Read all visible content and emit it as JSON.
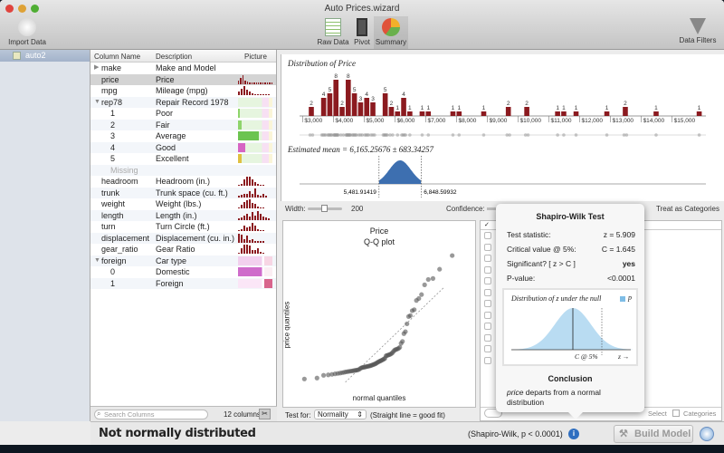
{
  "window": {
    "title": "Auto Prices.wizard"
  },
  "toolbar": {
    "import": "Import Data",
    "raw": "Raw Data",
    "pivot": "Pivot",
    "summary": "Summary",
    "filters": "Data Filters"
  },
  "sidebar": {
    "items": [
      {
        "label": "auto2"
      }
    ]
  },
  "columns": {
    "headers": [
      "Column Name",
      "Description",
      "Picture"
    ],
    "rows": [
      {
        "name": "make",
        "desc": "Make and Model",
        "tri": "▶",
        "spark": []
      },
      {
        "name": "price",
        "desc": "Price",
        "spark": [
          3,
          5,
          8,
          3,
          2,
          1,
          1,
          1,
          1,
          1,
          1,
          1,
          1,
          1,
          1,
          1
        ],
        "selected": true
      },
      {
        "name": "mpg",
        "desc": "Mileage (mpg)",
        "spark": [
          3,
          6,
          8,
          5,
          3,
          2,
          1,
          1,
          1,
          1,
          1,
          1
        ]
      },
      {
        "name": "rep78",
        "desc": "Repair Record 1978",
        "tri": "▼",
        "cat": true
      },
      {
        "name": "1",
        "desc": "Poor",
        "indent": true
      },
      {
        "name": "2",
        "desc": "Fair",
        "indent": true
      },
      {
        "name": "3",
        "desc": "Average",
        "indent": true
      },
      {
        "name": "4",
        "desc": "Good",
        "indent": true
      },
      {
        "name": "5",
        "desc": "Excellent",
        "indent": true
      },
      {
        "name": "Missing",
        "desc": "",
        "muted": true
      },
      {
        "name": "headroom",
        "desc": "Headroom (in.)",
        "spark": [
          1,
          2,
          6,
          8,
          8,
          6,
          3,
          2,
          1,
          1
        ]
      },
      {
        "name": "trunk",
        "desc": "Trunk space (cu. ft.)",
        "spark": [
          1,
          2,
          3,
          3,
          5,
          3,
          8,
          2,
          1,
          3,
          1
        ]
      },
      {
        "name": "weight",
        "desc": "Weight (lbs.)",
        "spark": [
          1,
          3,
          6,
          7,
          8,
          5,
          4,
          2,
          1,
          1
        ]
      },
      {
        "name": "length",
        "desc": "Length (in.)",
        "spark": [
          1,
          2,
          4,
          5,
          3,
          7,
          4,
          8,
          5,
          3,
          2,
          1
        ]
      },
      {
        "name": "turn",
        "desc": "Turn Circle (ft.)",
        "spark": [
          1,
          2,
          5,
          3,
          4,
          7,
          5,
          2,
          1,
          1
        ]
      },
      {
        "name": "displacement",
        "desc": "Displacement (cu. in.)",
        "spark": [
          8,
          7,
          3,
          6,
          2,
          3,
          1,
          1,
          1,
          1
        ]
      },
      {
        "name": "gear_ratio",
        "desc": "Gear Ratio",
        "spark": [
          1,
          5,
          8,
          8,
          7,
          3,
          3,
          5,
          2,
          1
        ]
      },
      {
        "name": "foreign",
        "desc": "Car type",
        "tri": "▼"
      },
      {
        "name": "0",
        "desc": "Domestic",
        "indent": true
      },
      {
        "name": "1",
        "desc": "Foreign",
        "indent": true
      }
    ],
    "search_placeholder": "Search Columns",
    "count": "12 columns"
  },
  "chart_data": [
    {
      "type": "bar",
      "title": "Distribution of Price",
      "bin_width": 200,
      "bins": [
        3200,
        3600,
        3800,
        4000,
        4200,
        4400,
        4600,
        4800,
        5000,
        5200,
        5600,
        5800,
        6000,
        6200,
        6400,
        6800,
        7000,
        7800,
        8000,
        8800,
        9600,
        10200,
        11200,
        11400,
        11800,
        12800,
        13400,
        14400,
        15800
      ],
      "values": [
        2,
        4,
        5,
        8,
        2,
        8,
        5,
        3,
        4,
        3,
        5,
        2,
        1,
        4,
        1,
        1,
        1,
        1,
        1,
        1,
        2,
        2,
        1,
        1,
        1,
        1,
        2,
        1,
        1
      ],
      "ticks": [
        "$3,000",
        "$4,000",
        "$5,000",
        "$6,000",
        "$7,000",
        "$8,000",
        "$9,000",
        "$10,000",
        "$11,000",
        "$12,000",
        "$13,000",
        "$14,000",
        "$15,000"
      ],
      "xlim": [
        2900,
        16100
      ]
    },
    {
      "type": "area",
      "title": "Estimated mean = 6,165.25676 ± 683.34257",
      "mean": 6165.25676,
      "lower": "5,481.91419",
      "upper": "6,848.59932",
      "lower_v": 5481.91419,
      "upper_v": 6848.59932
    },
    {
      "type": "scatter",
      "title": "Price",
      "subtitle": "Q-Q plot",
      "xlabel": "normal quantiles",
      "ylabel": "price quantiles"
    }
  ],
  "controls": {
    "width_label": "Width:",
    "width_value": "200",
    "confidence_label": "Confidence:",
    "treat": "Treat as Categories"
  },
  "test": {
    "label": "Test for:",
    "value": "Normality",
    "hint": "(Straight line = good fit)"
  },
  "rlist": {
    "select": "Select",
    "categories": "Categories"
  },
  "popover": {
    "title": "Shapiro-Wilk Test",
    "rows": [
      [
        "Test statistic:",
        "z = 5.909"
      ],
      [
        "Critical value @ 5%:",
        "C = 1.645"
      ],
      [
        "Significant? [ z > C ]",
        "yes"
      ],
      [
        "P-value:",
        "<0.0001"
      ]
    ],
    "chart_title": "Distribution of z under the null",
    "legend": "p",
    "c_label": "C @ 5%",
    "z_label": "z →",
    "conclusion_title": "Conclusion",
    "conclusion_var": "price",
    "conclusion_text": " departs from a normal distribution"
  },
  "status": {
    "headline": "Not normally distributed",
    "detail": "(Shapiro-Wilk, p < 0.0001)",
    "build": "Build Model"
  },
  "colors": {
    "bar": "#8b1a1f",
    "mean": "#3d6fb0",
    "null": "#b9dcf2"
  }
}
